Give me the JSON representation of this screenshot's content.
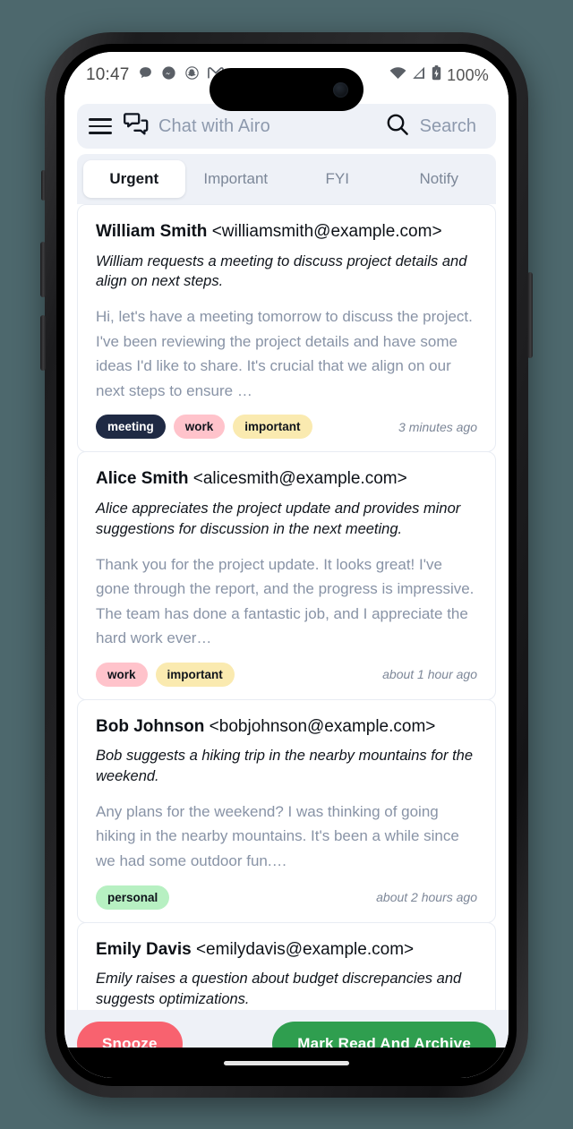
{
  "device": {
    "background_color": "#4d686d",
    "frame_color": "#1b1b1d"
  },
  "status_bar": {
    "time": "10:47",
    "battery_percent": "100%",
    "left_icons": [
      "speech-bubble-icon",
      "messenger-icon",
      "snapchat-icon",
      "gmail-icon"
    ],
    "right_icons": [
      "wifi-icon",
      "cellular-signal-icon",
      "battery-charging-icon"
    ]
  },
  "header": {
    "menu_icon": "hamburger-menu-icon",
    "chat_icon": "chat-bubbles-icon",
    "chat_label": "Chat with Airo",
    "search_icon": "search-icon",
    "search_placeholder": "Search",
    "search_value": ""
  },
  "tabs": {
    "active_index": 0,
    "items": [
      {
        "label": "Urgent"
      },
      {
        "label": "Important"
      },
      {
        "label": "FYI"
      },
      {
        "label": "Notify"
      }
    ]
  },
  "tag_colors": {
    "meeting": {
      "bg": "#1f2a44",
      "fg": "#ffffff"
    },
    "work": {
      "bg": "#ffc3cb",
      "fg": "#10151c"
    },
    "important": {
      "bg": "#faeab0",
      "fg": "#10151c"
    },
    "personal": {
      "bg": "#b7f0c2",
      "fg": "#10151c"
    }
  },
  "emails": [
    {
      "sender_name": "William Smith",
      "sender_email": "<williamsmith@example.com>",
      "summary": "William requests a meeting to discuss project details and align on next steps.",
      "snippet": "Hi, let's have a meeting tomorrow to discuss the project. I've been reviewing the project details and have some ideas I'd like to share. It's crucial that we align on our next steps to ensure …",
      "tags": [
        "meeting",
        "work",
        "important"
      ],
      "time": "3 minutes ago"
    },
    {
      "sender_name": "Alice Smith",
      "sender_email": "<alicesmith@example.com>",
      "summary": "Alice appreciates the project update and provides minor suggestions for discussion in the next meeting.",
      "snippet": "Thank you for the project update. It looks great! I've gone through the report, and the progress is impressive. The team has done a fantastic job, and I appreciate the hard work ever…",
      "tags": [
        "work",
        "important"
      ],
      "time": "about 1 hour ago"
    },
    {
      "sender_name": "Bob Johnson",
      "sender_email": "<bobjohnson@example.com>",
      "summary": "Bob suggests a hiking trip in the nearby mountains for the weekend.",
      "snippet": "Any plans for the weekend? I was thinking of going hiking in the nearby mountains. It's been a while since we had some outdoor fun.…",
      "tags": [
        "personal"
      ],
      "time": "about 2 hours ago"
    },
    {
      "sender_name": "Emily Davis",
      "sender_email": "<emilydavis@example.com>",
      "summary": "Emily raises a question about budget discrepancies and suggests optimizations.",
      "snippet": "",
      "tags": [],
      "time": ""
    }
  ],
  "action_bar": {
    "snooze_label": "Snooze",
    "snooze_color": "#f8626f",
    "archive_label": "Mark Read And Archive",
    "archive_color": "#2f9e4f"
  }
}
